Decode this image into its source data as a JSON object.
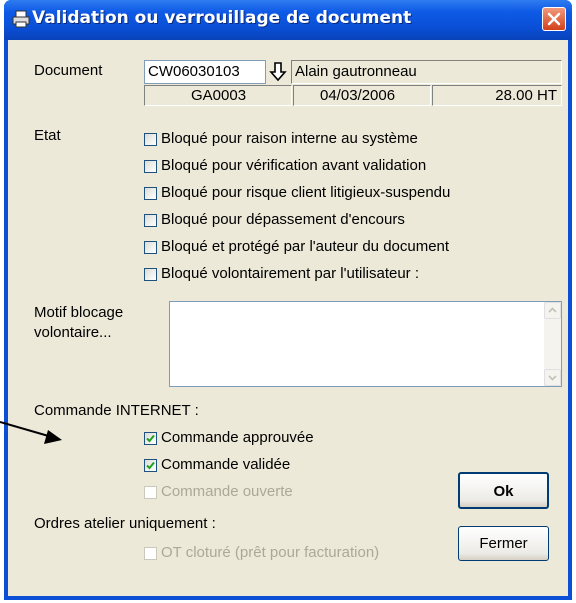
{
  "window": {
    "title": "Validation ou verrouillage de document"
  },
  "document": {
    "label": "Document",
    "code": "CW06030103",
    "client": "Alain gautronneau",
    "ref": "GA0003",
    "date": "04/03/2006",
    "amount": "28.00 HT"
  },
  "etat": {
    "label": "Etat",
    "items": [
      {
        "label": "Bloqué pour raison interne au système",
        "checked": false
      },
      {
        "label": "Bloqué pour vérification avant validation",
        "checked": false
      },
      {
        "label": "Bloqué pour risque client litigieux-suspendu",
        "checked": false
      },
      {
        "label": "Bloqué pour dépassement d'encours",
        "checked": false
      },
      {
        "label": "Bloqué et protégé par l'auteur du document",
        "checked": false
      },
      {
        "label": "Bloqué volontairement par l'utilisateur :",
        "checked": false
      }
    ]
  },
  "motif": {
    "label_line1": "Motif blocage",
    "label_line2": "volontaire...",
    "value": ""
  },
  "internet": {
    "label": "Commande INTERNET :",
    "approved": {
      "label": "Commande approuvée",
      "checked": true
    },
    "validated": {
      "label": "Commande validée",
      "checked": true
    },
    "open": {
      "label": "Commande ouverte",
      "checked": false,
      "disabled": true
    }
  },
  "atelier": {
    "label": "Ordres atelier uniquement :",
    "ot": {
      "label": "OT cloturé (prêt pour facturation)",
      "checked": false,
      "disabled": true
    }
  },
  "buttons": {
    "ok": "Ok",
    "close": "Fermer"
  },
  "icons": {
    "title": "printer-icon",
    "close": "close-icon",
    "lookup": "down-arrow-icon",
    "annotation": "arrow-icon"
  }
}
